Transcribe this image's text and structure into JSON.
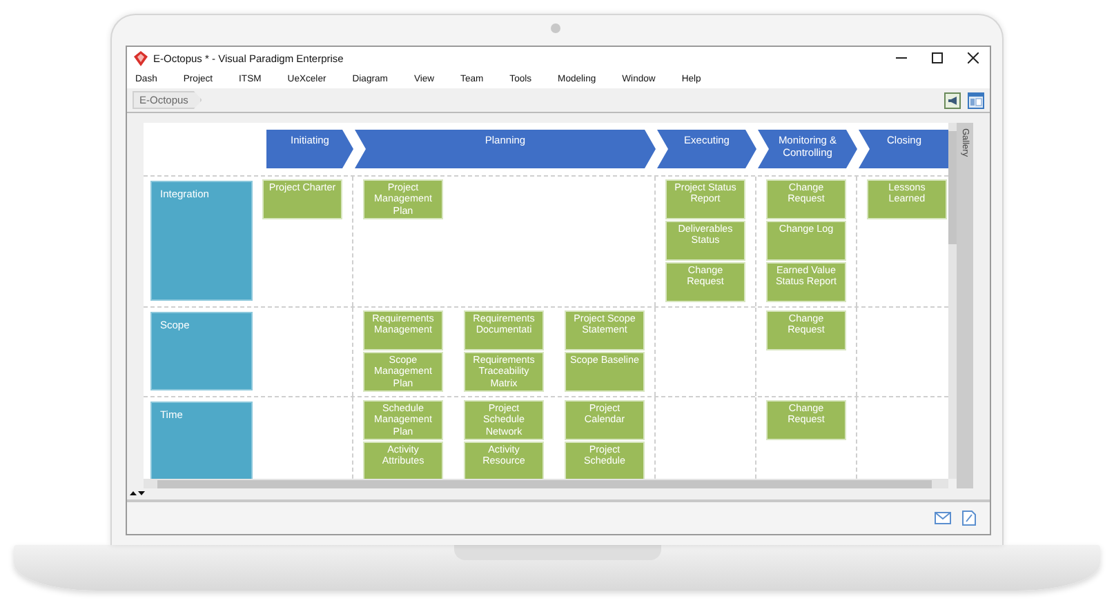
{
  "window": {
    "title": "E-Octopus * - Visual Paradigm Enterprise"
  },
  "menu": [
    "Dash",
    "Project",
    "ITSM",
    "UeXceler",
    "Diagram",
    "View",
    "Team",
    "Tools",
    "Modeling",
    "Window",
    "Help"
  ],
  "breadcrumb": "E-Octopus",
  "diagram": {
    "phases": [
      {
        "name": "Initiating"
      },
      {
        "name": "Planning"
      },
      {
        "name": "Executing"
      },
      {
        "name": "Monitoring & Controlling"
      },
      {
        "name": "Closing"
      }
    ],
    "knowledge_areas": [
      {
        "name": "Integration",
        "initiating": [
          [
            "Project Charter"
          ]
        ],
        "planning": [
          [
            "Project Management Plan"
          ]
        ],
        "executing": [
          [
            "Project Status Report",
            "Deliverables Status",
            "Change Request"
          ]
        ],
        "monitoring_controlling": [
          [
            "Change Request",
            "Change Log",
            "Earned Value Status Report"
          ]
        ],
        "closing": [
          [
            "Lessons Learned"
          ]
        ]
      },
      {
        "name": "Scope",
        "planning": [
          [
            "Requirements Management",
            "Scope Management Plan"
          ],
          [
            "Requirements Documentati",
            "Requirements Traceability Matrix"
          ],
          [
            "Project Scope Statement",
            "Scope Baseline"
          ]
        ],
        "monitoring_controlling": [
          [
            "Change Request"
          ]
        ]
      },
      {
        "name": "Time",
        "planning": [
          [
            "Schedule Management Plan",
            "Activity Attributes"
          ],
          [
            "Project Schedule Network",
            "Activity Resource"
          ],
          [
            "Project Calendar",
            "Project Schedule"
          ]
        ],
        "monitoring_controlling": [
          [
            "Change Request"
          ]
        ]
      }
    ]
  },
  "gallery": "Gallery"
}
